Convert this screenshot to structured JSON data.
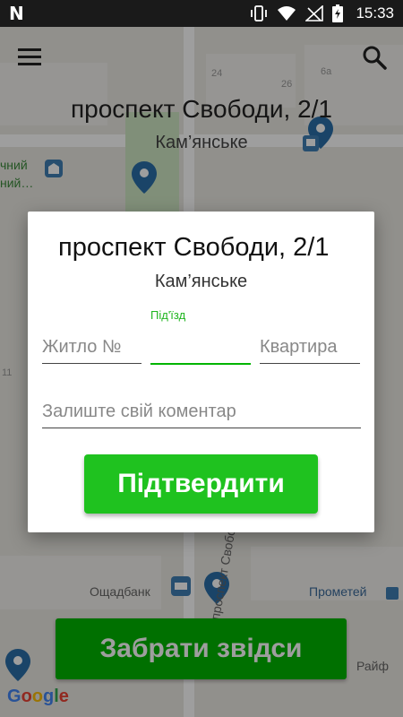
{
  "status_bar": {
    "app_logo": "N",
    "time": "15:33",
    "icons": [
      "vibrate-icon",
      "wifi-icon",
      "signal-icon",
      "battery-icon"
    ]
  },
  "map": {
    "title": "проспект Свободи, 2/1",
    "subtitle": "Кам’янське",
    "labels": {
      "park_line1": "чний",
      "park_line2": "ний…",
      "bank": "Ощадбанк",
      "store": "Прометей",
      "street": "проспект Свобо",
      "right_edge": "Райф"
    },
    "numbers": {
      "n24": "24",
      "n26": "26",
      "n6a": "6а",
      "n11": "11"
    }
  },
  "dialog": {
    "title": "проспект Свободи, 2/1",
    "city": "Кам’янське",
    "fields": {
      "housing": {
        "placeholder": "Житло №",
        "value": ""
      },
      "entrance": {
        "label": "Під'їзд",
        "value": ""
      },
      "apartment": {
        "placeholder": "Квартира",
        "value": ""
      },
      "comment": {
        "placeholder": "Залиште свій коментар",
        "value": ""
      }
    },
    "confirm_label": "Підтвердити"
  },
  "bottom": {
    "take_label": "Забрати звідси",
    "google": "Google"
  },
  "colors": {
    "accent_green": "#1fc21f",
    "take_green": "#00b500",
    "status_bar": "#1a1a1a",
    "pin_blue": "#2a6fa8"
  }
}
